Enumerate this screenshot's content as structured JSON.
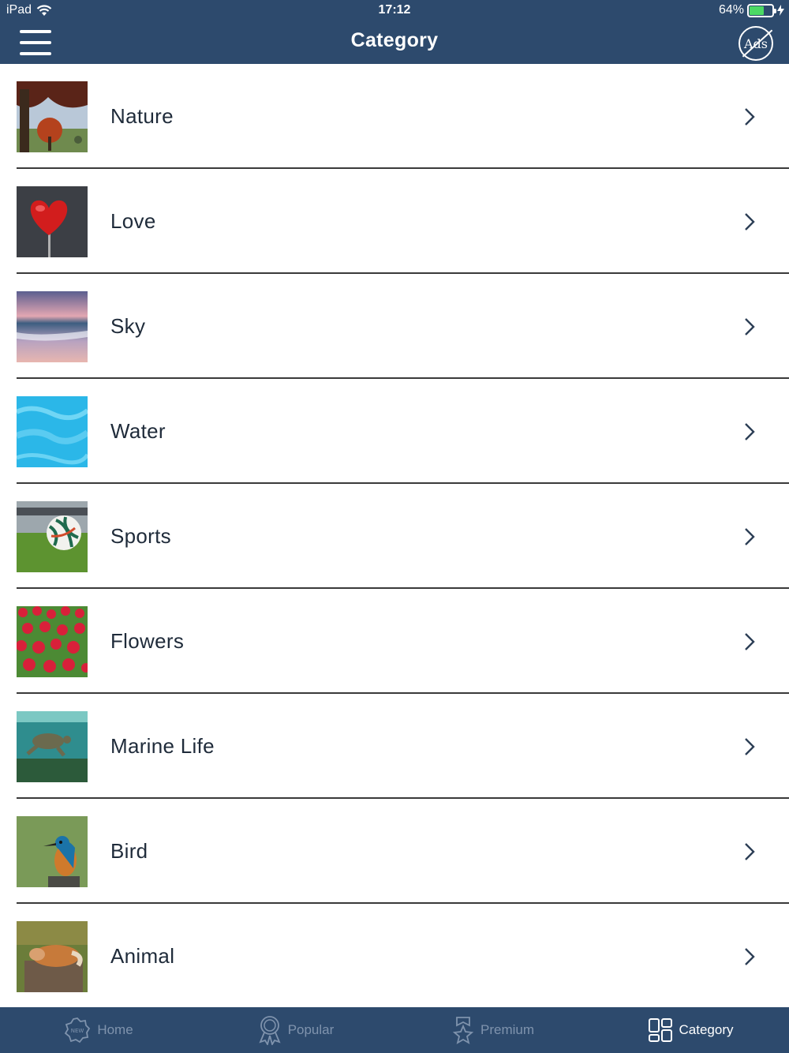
{
  "status_bar": {
    "device": "iPad",
    "time": "17:12",
    "battery": "64%",
    "battery_level": 0.64
  },
  "nav": {
    "title": "Category",
    "ads_label": "Ads"
  },
  "categories": [
    {
      "label": "Nature"
    },
    {
      "label": "Love"
    },
    {
      "label": "Sky"
    },
    {
      "label": "Water"
    },
    {
      "label": "Sports"
    },
    {
      "label": "Flowers"
    },
    {
      "label": "Marine Life"
    },
    {
      "label": "Bird"
    },
    {
      "label": "Animal"
    }
  ],
  "tabs": [
    {
      "label": "Home",
      "icon": "new-badge-icon"
    },
    {
      "label": "Popular",
      "icon": "award-ribbon-icon"
    },
    {
      "label": "Premium",
      "icon": "star-ribbon-icon"
    },
    {
      "label": "Category",
      "icon": "grid-icon",
      "active": true
    }
  ],
  "colors": {
    "bar": "#2d4a6d",
    "tab_inactive": "#7f93ad",
    "tab_active": "#ffffff",
    "text": "#1f2b3a"
  }
}
